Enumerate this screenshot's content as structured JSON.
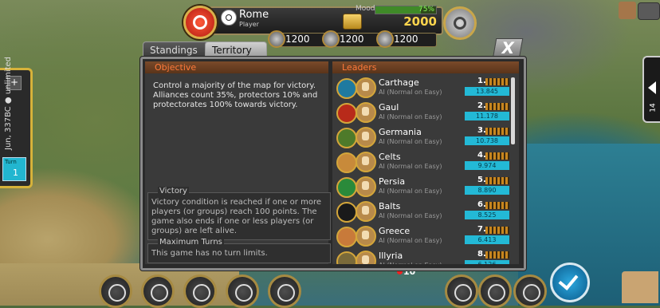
{
  "player": {
    "name": "Rome",
    "role": "Player"
  },
  "hud": {
    "mood_label": "Mood:",
    "mood_value": "75%",
    "mood_fraction": 0.75,
    "gold": "2000",
    "resources": [
      "1200",
      "1200",
      "1200"
    ]
  },
  "left_panel": {
    "plus": "+",
    "date": "Jun, 337BC",
    "limit": "unlimited",
    "turn_label": "Turn",
    "turn": "1"
  },
  "right_panel": {
    "number": "14"
  },
  "tabs": {
    "standings": "Standings",
    "territory": "Territory"
  },
  "close_label": "X",
  "objective": {
    "title": "Objective",
    "text": "Control a majority of the map for victory. Alliances count 35%, protectors 10% and protectorates 100% towards victory.",
    "victory_title": "Victory",
    "victory_text": "Victory condition is reached if one or more players (or groups) reach 100 points. The game also ends if one or less players (or groups) are left alive.",
    "turns_title": "Maximum Turns",
    "turns_text": "This game has no turn limits."
  },
  "leaders": {
    "title": "Leaders",
    "rows": [
      {
        "nation": "Carthage",
        "ai": "AI (Normal on Easy)",
        "rank": "1.",
        "score": "13.845",
        "color": "#1f7aa0"
      },
      {
        "nation": "Gaul",
        "ai": "AI (Normal on Easy)",
        "rank": "2.",
        "score": "11.178",
        "color": "#b82a1a"
      },
      {
        "nation": "Germania",
        "ai": "AI (Normal on Easy)",
        "rank": "3.",
        "score": "10.738",
        "color": "#4e7a2a"
      },
      {
        "nation": "Celts",
        "ai": "AI (Normal on Easy)",
        "rank": "4.",
        "score": "9.974",
        "color": "#c88a3a"
      },
      {
        "nation": "Persia",
        "ai": "AI (Normal on Easy)",
        "rank": "5.",
        "score": "8.890",
        "color": "#2a8a3a"
      },
      {
        "nation": "Balts",
        "ai": "AI (Normal on Easy)",
        "rank": "6.",
        "score": "8.525",
        "color": "#1a1a1a"
      },
      {
        "nation": "Greece",
        "ai": "AI (Normal on Easy)",
        "rank": "7.",
        "score": "6.413",
        "color": "#c87a3a"
      },
      {
        "nation": "Illyria",
        "ai": "AI (Normal on Easy)",
        "rank": "8.",
        "score": "6.126",
        "color": "#7a6a3a"
      }
    ]
  },
  "map": {
    "unit_count": "10"
  }
}
